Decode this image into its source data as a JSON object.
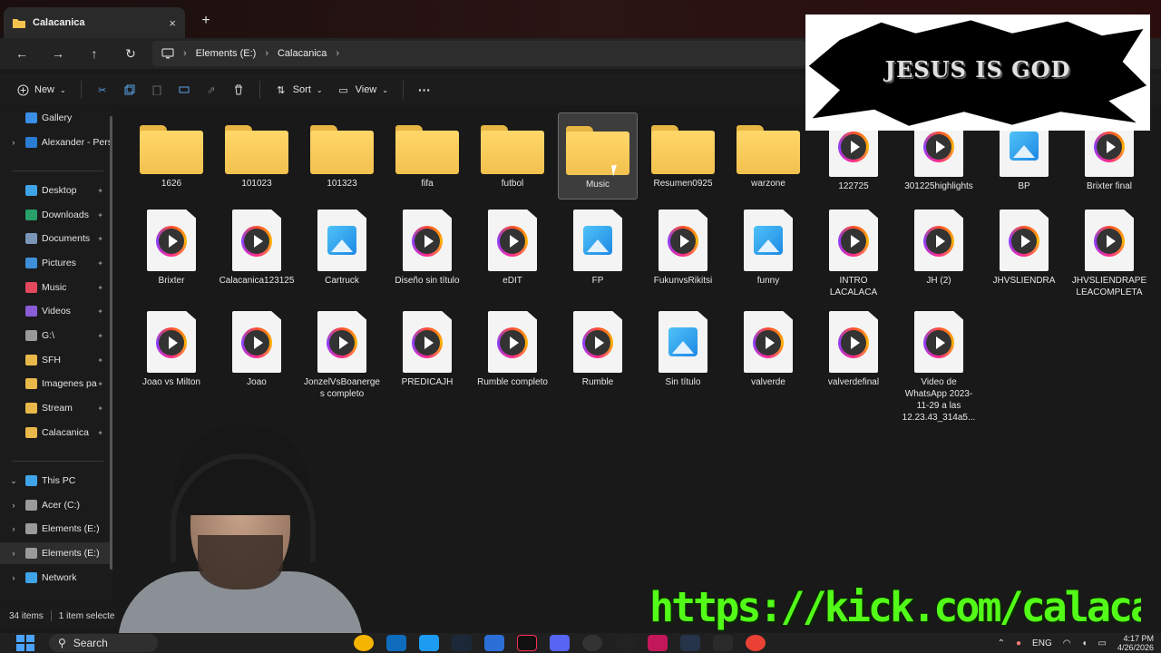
{
  "window": {
    "tab_title": "Calacanica",
    "tab_close": "×",
    "new_tab": "+"
  },
  "nav": {
    "back": "←",
    "forward": "→",
    "up": "↑",
    "refresh": "↻",
    "breadcrumb": [
      "Elements (E:)",
      "Calacanica"
    ],
    "sep": "›"
  },
  "commands": {
    "new_label": "New",
    "sort_label": "Sort",
    "view_label": "View",
    "more": "···"
  },
  "sidebar": {
    "items": [
      {
        "label": "Gallery",
        "chev": "",
        "color": "#3a8ee6",
        "pinned": false
      },
      {
        "label": "Alexander - Pers",
        "chev": "›",
        "color": "#2b7cd3",
        "pinned": false
      },
      {
        "label": "Desktop",
        "chev": "",
        "color": "#3fa3e8",
        "pinned": true
      },
      {
        "label": "Downloads",
        "chev": "",
        "color": "#28a06a",
        "pinned": true
      },
      {
        "label": "Documents",
        "chev": "",
        "color": "#7a95b5",
        "pinned": true
      },
      {
        "label": "Pictures",
        "chev": "",
        "color": "#3d8fd8",
        "pinned": true
      },
      {
        "label": "Music",
        "chev": "",
        "color": "#e2495c",
        "pinned": true
      },
      {
        "label": "Videos",
        "chev": "",
        "color": "#8a5cd6",
        "pinned": true
      },
      {
        "label": "G:\\",
        "chev": "",
        "color": "#9a9a9a",
        "pinned": true
      },
      {
        "label": "SFH",
        "chev": "",
        "color": "#e9b84a",
        "pinned": true
      },
      {
        "label": "Imagenes pa",
        "chev": "",
        "color": "#e9b84a",
        "pinned": true
      },
      {
        "label": "Stream",
        "chev": "",
        "color": "#e9b84a",
        "pinned": true
      },
      {
        "label": "Calacanica",
        "chev": "",
        "color": "#e9b84a",
        "pinned": true
      },
      {
        "label": "This PC",
        "chev": "⌄",
        "color": "#3fa3e8",
        "pinned": false
      },
      {
        "label": "Acer (C:)",
        "chev": "›",
        "color": "#9a9a9a",
        "pinned": false
      },
      {
        "label": "Elements (E:)",
        "chev": "›",
        "color": "#9a9a9a",
        "pinned": false
      },
      {
        "label": "Elements (E:)",
        "chev": "›",
        "color": "#9a9a9a",
        "pinned": false
      },
      {
        "label": "Network",
        "chev": "›",
        "color": "#3fa3e8",
        "pinned": false
      }
    ],
    "pin_glyph": "✦"
  },
  "files": [
    {
      "name": "1626",
      "kind": "folder"
    },
    {
      "name": "101023",
      "kind": "folder"
    },
    {
      "name": "101323",
      "kind": "folder"
    },
    {
      "name": "fifa",
      "kind": "folder"
    },
    {
      "name": "futbol",
      "kind": "folder"
    },
    {
      "name": "Music",
      "kind": "folder",
      "selected": true
    },
    {
      "name": "Resumen0925",
      "kind": "folder"
    },
    {
      "name": "warzone",
      "kind": "folder"
    },
    {
      "name": "122725",
      "kind": "video"
    },
    {
      "name": "301225highlights",
      "kind": "video"
    },
    {
      "name": "BP",
      "kind": "image"
    },
    {
      "name": "Brixter final",
      "kind": "video"
    },
    {
      "name": "Brixter",
      "kind": "video"
    },
    {
      "name": "Calacanica123125",
      "kind": "video"
    },
    {
      "name": "Cartruck",
      "kind": "image"
    },
    {
      "name": "Diseño sin título",
      "kind": "video"
    },
    {
      "name": "eDIT",
      "kind": "video"
    },
    {
      "name": "FP",
      "kind": "image"
    },
    {
      "name": "FukunvsRikitsi",
      "kind": "video"
    },
    {
      "name": "funny",
      "kind": "image"
    },
    {
      "name": "INTRO LACALACA",
      "kind": "video"
    },
    {
      "name": "JH (2)",
      "kind": "video"
    },
    {
      "name": "JHVSLIENDRA",
      "kind": "video"
    },
    {
      "name": "JHVSLIENDRAPELEACOMPLETA",
      "kind": "video"
    },
    {
      "name": "Joao vs Milton",
      "kind": "video"
    },
    {
      "name": "Joao",
      "kind": "video"
    },
    {
      "name": "JonzelVsBoanerges completo",
      "kind": "video"
    },
    {
      "name": "PREDICAJH",
      "kind": "video"
    },
    {
      "name": "Rumble completo",
      "kind": "video"
    },
    {
      "name": "Rumble",
      "kind": "video"
    },
    {
      "name": "Sin título",
      "kind": "image"
    },
    {
      "name": "valverde",
      "kind": "video"
    },
    {
      "name": "valverdefinal",
      "kind": "video"
    },
    {
      "name": "Video de WhatsApp 2023-11-29 a las 12.23.43_314a5...",
      "kind": "video"
    }
  ],
  "status": {
    "count": "34 items",
    "selected": "1 item selecte"
  },
  "taskbar": {
    "search_label": "Search",
    "lang": "ENG",
    "time": "4:17 PM",
    "date": "4/26/2026"
  },
  "overlays": {
    "banner_text": "JESUS IS GOD",
    "kick_url": "https://kick.com/calacanica"
  },
  "colors": {
    "folder": "#f2c14e",
    "accent": "#4aa3ff",
    "kick_green": "#53fc18"
  }
}
